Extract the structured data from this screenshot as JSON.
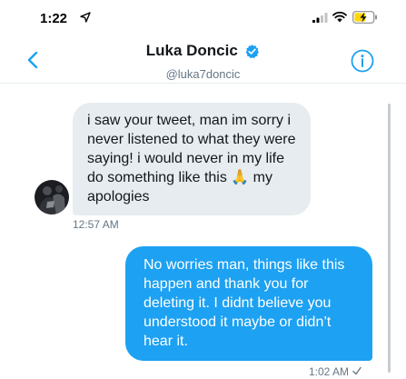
{
  "status_bar": {
    "time": "1:22",
    "location_icon": "location-arrow-icon",
    "signal_icon": "cellular-signal-icon",
    "wifi_icon": "wifi-icon",
    "battery_icon": "battery-charging-icon",
    "battery_color": "#ffd60a"
  },
  "header": {
    "display_name": "Luka Doncic",
    "handle": "@luka7doncic",
    "back_icon": "chevron-left-icon",
    "verified_icon": "verified-badge-icon",
    "info_icon": "info-icon",
    "accent_color": "#1da1f2"
  },
  "conversation": {
    "incoming": {
      "text": "i saw your tweet, man im sorry i never listened to what they were saying! i would never in my life do something like this 🙏 my apologies",
      "timestamp": "12:57 AM",
      "bubble_color": "#e6ecf0"
    },
    "outgoing": {
      "text": "No worries man, things like this happen and thank you for deleting it. I didnt believe you understood it maybe or didn’t hear it.",
      "timestamp": "1:02 AM",
      "status_icon": "checkmark-icon",
      "bubble_color": "#1da1f2"
    }
  }
}
